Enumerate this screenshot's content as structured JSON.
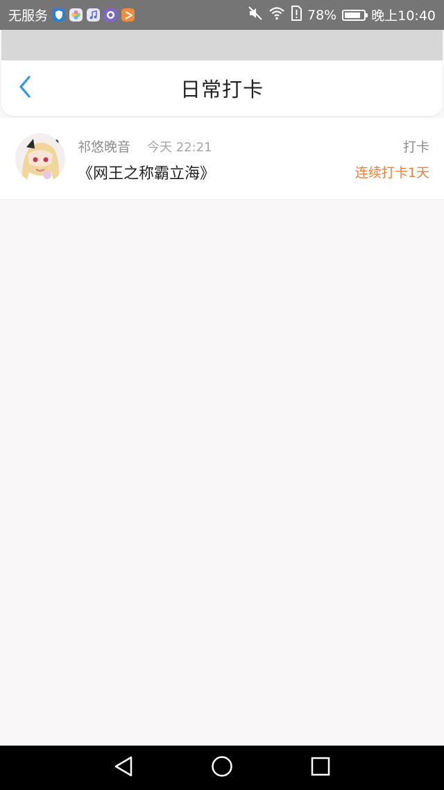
{
  "status_bar": {
    "carrier": "无服务",
    "battery": "78%",
    "battery_level": 0.78,
    "time": "晚上10:40",
    "app_icons": [
      "shield-app-icon",
      "flower-app-icon",
      "music-app-icon",
      "globe-app-icon",
      "play-app-icon"
    ],
    "status_icons": [
      "mute-icon",
      "wifi-icon",
      "sim-alert-icon",
      "battery-icon"
    ]
  },
  "header": {
    "title": "日常打卡",
    "back_icon": "chevron-left-icon"
  },
  "checkins": [
    {
      "user": "祁悠晚音",
      "time": "今天 22:21",
      "title": "《网王之称霸立海》",
      "type": "打卡",
      "streak": "连续打卡1天",
      "avatar_icon": "avatar-image"
    }
  ],
  "colors": {
    "accent_blue": "#2b9ae6",
    "streak_orange": "#ee7f3a",
    "status_bar": "#757575",
    "background": "#f9f7f7"
  },
  "nav_bar": {
    "icons": [
      "back-triangle-icon",
      "home-circle-icon",
      "recents-square-icon"
    ]
  }
}
